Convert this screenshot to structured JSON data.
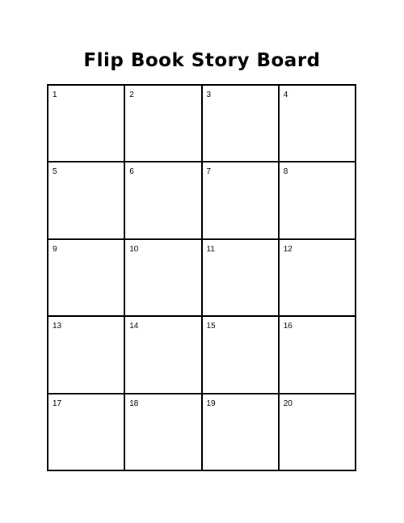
{
  "title": "Flip Book Story Board",
  "panels": [
    "1",
    "2",
    "3",
    "4",
    "5",
    "6",
    "7",
    "8",
    "9",
    "10",
    "11",
    "12",
    "13",
    "14",
    "15",
    "16",
    "17",
    "18",
    "19",
    "20"
  ]
}
